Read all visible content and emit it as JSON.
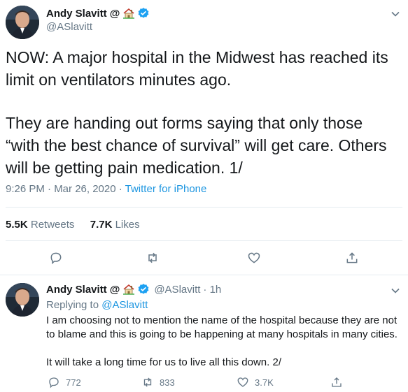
{
  "main_tweet": {
    "author": {
      "name": "Andy Slavitt",
      "at_sign": "@",
      "house_icon": "house-icon",
      "verified_icon": "verified-badge-icon",
      "handle": "@ASlavitt"
    },
    "paragraph_1": "NOW: A major hospital in the Midwest has reached its limit on ventilators minutes ago.",
    "paragraph_2": "They are handing out forms saying that only those “with the best chance of survival” will get care. Others will be getting pain medication. 1/",
    "timestamp": "9:26 PM · Mar 26, 2020 · ",
    "source": "Twitter for iPhone",
    "stats": {
      "retweets_count": "5.5K",
      "retweets_label": "Retweets",
      "likes_count": "7.7K",
      "likes_label": "Likes"
    },
    "actions": [
      "reply-icon",
      "retweet-icon",
      "like-icon",
      "share-icon"
    ]
  },
  "reply_tweet": {
    "author": {
      "name": "Andy Slavitt",
      "at_sign": "@",
      "handle": "@ASlavitt",
      "time": "· 1h"
    },
    "replying_to_label": "Replying to ",
    "replying_to_handle": "@ASlavitt",
    "paragraph_1": "I am choosing not to mention the name of the hospital because they are not to blame and this is going to be happening at many hospitals in many cities.",
    "paragraph_2": "It will take a long time for us to live all this down. 2/",
    "counts": {
      "replies": "772",
      "retweets": "833",
      "likes": "3.7K"
    }
  },
  "colors": {
    "accent": "#1b95e0",
    "muted": "#657786",
    "text": "#14171a",
    "divider": "#e6ecf0"
  }
}
